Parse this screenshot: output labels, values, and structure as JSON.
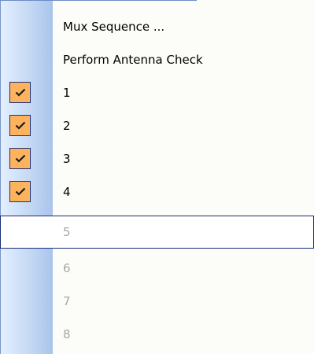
{
  "menu": {
    "items": [
      {
        "label": "Mux Sequence ...",
        "checked": false,
        "disabled": false,
        "highlighted": false
      },
      {
        "label": "Perform Antenna Check",
        "checked": false,
        "disabled": false,
        "highlighted": false
      },
      {
        "label": "1",
        "checked": true,
        "disabled": false,
        "highlighted": false
      },
      {
        "label": "2",
        "checked": true,
        "disabled": false,
        "highlighted": false
      },
      {
        "label": "3",
        "checked": true,
        "disabled": false,
        "highlighted": false
      },
      {
        "label": "4",
        "checked": true,
        "disabled": false,
        "highlighted": false
      },
      {
        "label": "5",
        "checked": false,
        "disabled": true,
        "highlighted": true
      },
      {
        "label": "6",
        "checked": false,
        "disabled": true,
        "highlighted": false
      },
      {
        "label": "7",
        "checked": false,
        "disabled": true,
        "highlighted": false
      },
      {
        "label": "8",
        "checked": false,
        "disabled": true,
        "highlighted": false
      }
    ]
  },
  "colors": {
    "check_background": "#fdb35e",
    "highlight_border": "#1a2d7c",
    "disabled_text": "#a7a79f"
  },
  "icons": {
    "check": "check-icon"
  }
}
